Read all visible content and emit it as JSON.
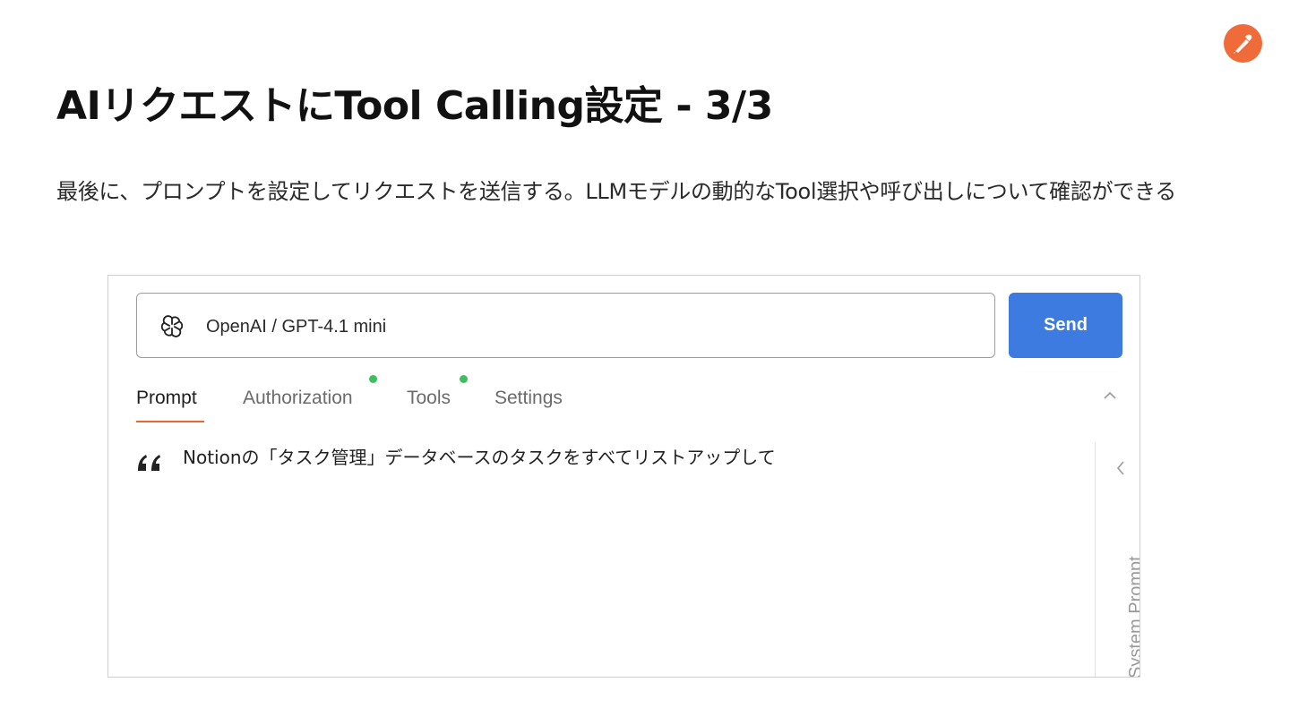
{
  "slide": {
    "title": "AIリクエストにTool Calling設定 - 3/3",
    "description": "最後に、プロンプトを設定してリクエストを送信する。LLMモデルの動的なTool選択や呼び出しについて確認ができる"
  },
  "logo": {
    "icon": "postman-logo-icon",
    "color": "#ef6c3a"
  },
  "request": {
    "model_label": "OpenAI / GPT-4.1 mini",
    "model_icon": "openai-icon",
    "send_label": "Send",
    "send_color": "#3d7be0"
  },
  "tabs": [
    {
      "label": "Prompt",
      "active": true,
      "indicator": false
    },
    {
      "label": "Authorization",
      "active": false,
      "indicator": true
    },
    {
      "label": "Tools",
      "active": false,
      "indicator": true
    },
    {
      "label": "Settings",
      "active": false,
      "indicator": false
    }
  ],
  "prompt": {
    "text": "Notionの「タスク管理」データベースのタスクをすべてリストアップして",
    "icon": "quote-icon"
  },
  "side_panel": {
    "label": "System Prompt",
    "icon": "chevron-left-icon"
  },
  "colors": {
    "active_tab_underline": "#e8692f",
    "indicator_dot": "#3ebf5e"
  }
}
